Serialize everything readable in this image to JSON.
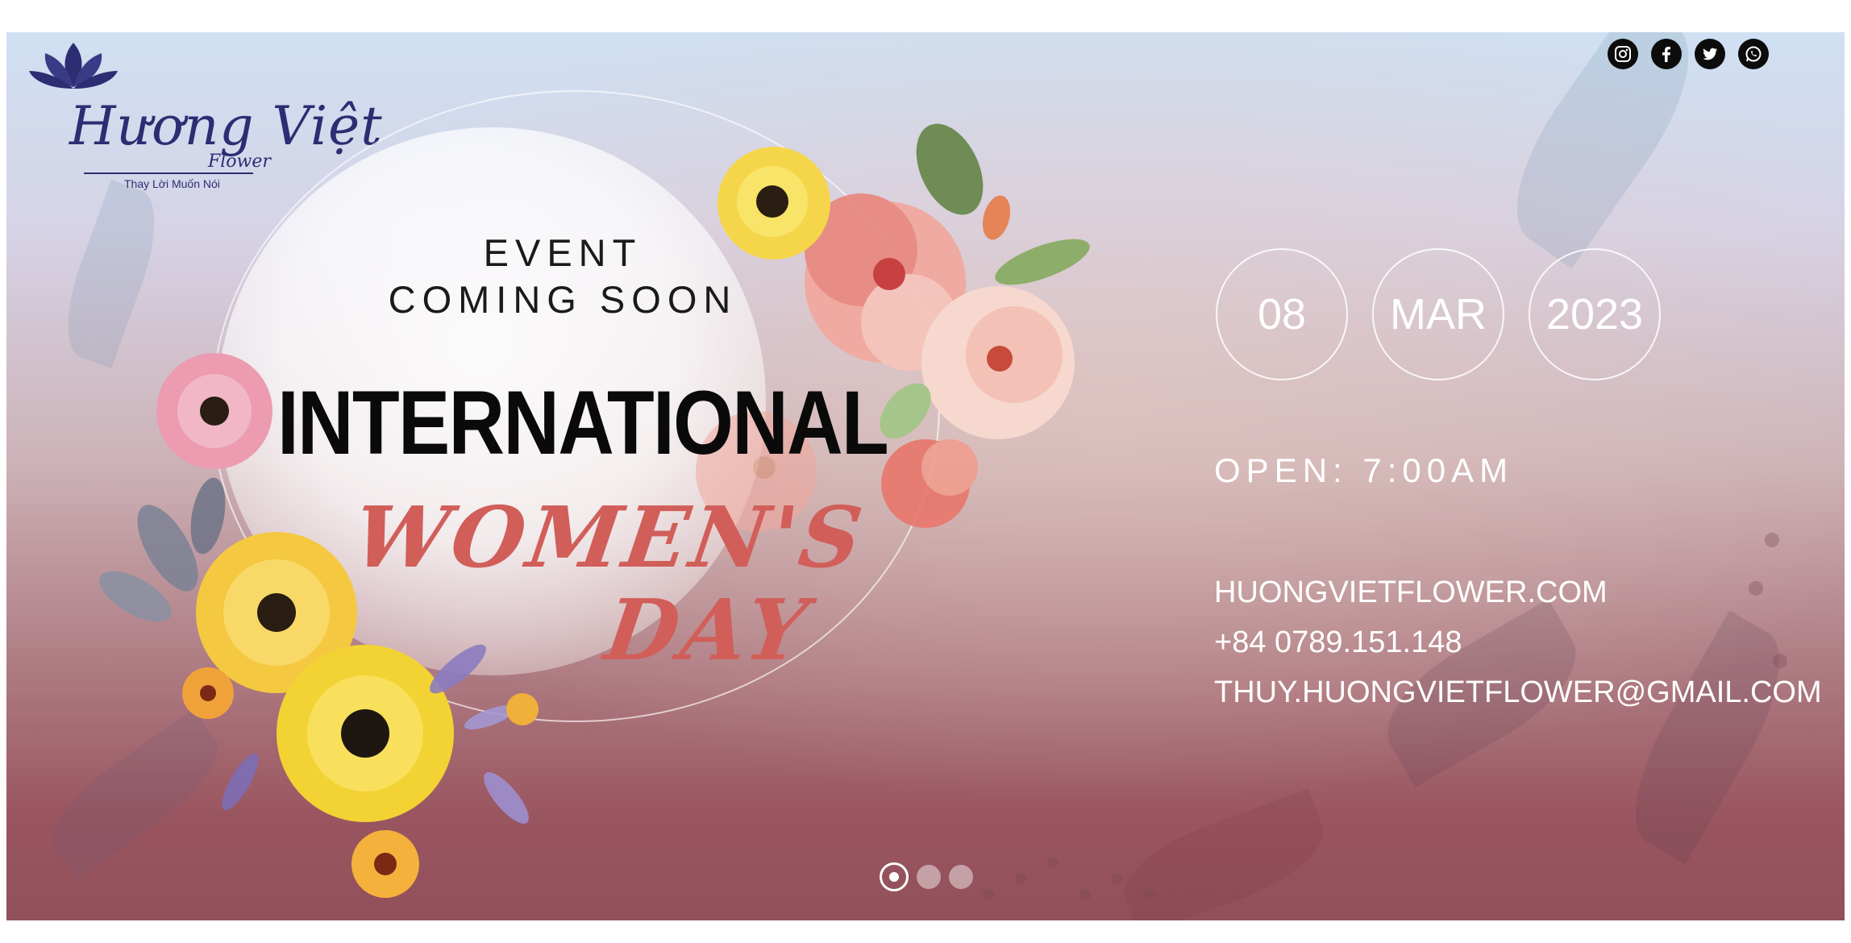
{
  "brand": {
    "logo_script": "Hương Việt",
    "logo_sub": "Flower",
    "tagline": "Thay Lời Muốn Nói"
  },
  "social": [
    {
      "name": "instagram-icon",
      "glyph": "◎"
    },
    {
      "name": "facebook-icon",
      "glyph": "f"
    },
    {
      "name": "twitter-icon",
      "glyph": "🐦"
    },
    {
      "name": "whatsapp-icon",
      "glyph": "✆"
    }
  ],
  "event": {
    "line1": "EVENT",
    "line2": "COMING SOON",
    "headline": "INTERNATIONAL",
    "womens": "WOMEN'S",
    "day": "DAY"
  },
  "date": {
    "day": "08",
    "month": "MAR",
    "year": "2023"
  },
  "open_text": "OPEN: 7:00AM",
  "contacts": {
    "website": "HUONGVIETFLOWER.COM",
    "phone": "+84 0789.151.148",
    "email": "THUY.HUONGVIETFLOWER@GMAIL.COM"
  },
  "carousel": {
    "slide_count": 3,
    "active_index": 0
  },
  "colors": {
    "accent_red": "#d15e59",
    "logo_navy": "#2c2d72"
  }
}
